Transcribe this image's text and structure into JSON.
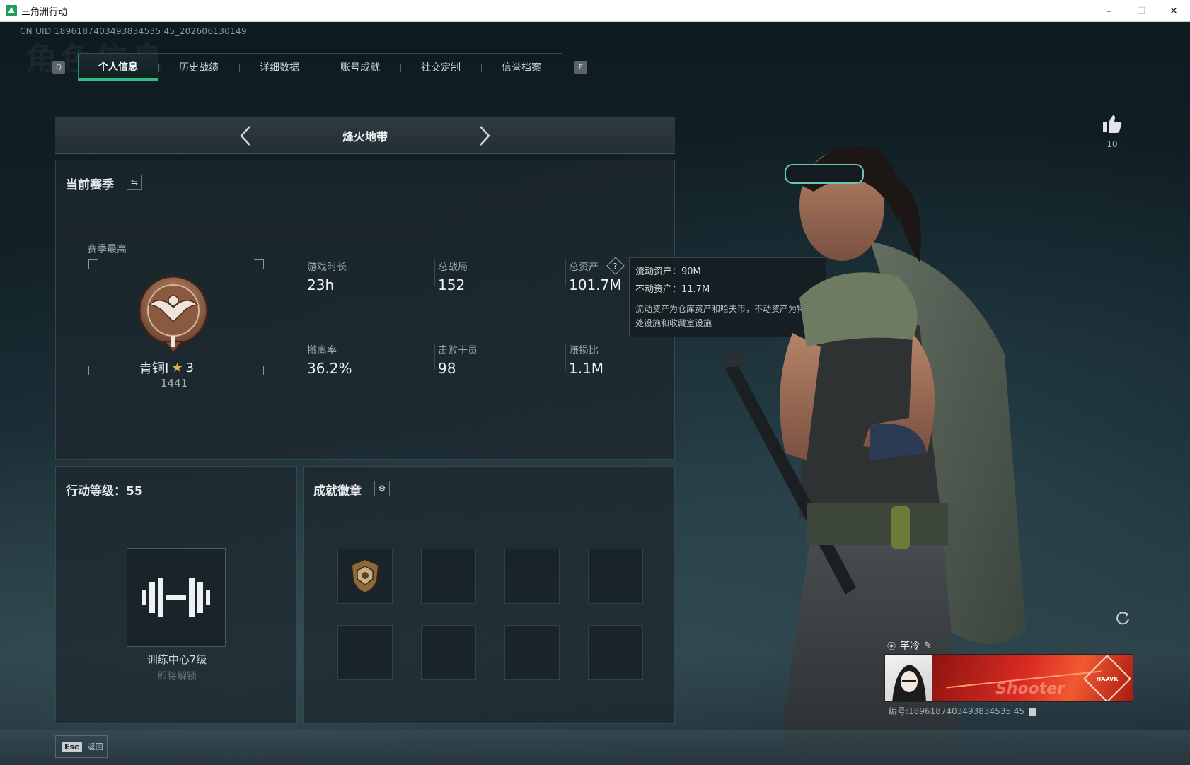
{
  "window": {
    "title": "三角洲行动",
    "controls": [
      "–",
      "☐",
      "✕"
    ]
  },
  "uid_line": "CN UID 1896187403493834535 45_202606130149",
  "watermark": "角色信息",
  "tabs": {
    "left_key": "Q",
    "right_key": "E",
    "items": [
      {
        "label": "个人信息",
        "active": true
      },
      {
        "label": "历史战绩",
        "active": false
      },
      {
        "label": "详细数据",
        "active": false
      },
      {
        "label": "账号成就",
        "active": false
      },
      {
        "label": "社交定制",
        "active": false
      },
      {
        "label": "信誉档案",
        "active": false
      }
    ]
  },
  "mode": {
    "title": "烽火地带"
  },
  "season": {
    "title": "当前赛季",
    "best_label": "赛季最高",
    "rank_name": "青铜I",
    "rank_stars": "3",
    "rank_score": "1441",
    "stats": {
      "play_time_label": "游戏时长",
      "play_time": "23h",
      "total_matches_label": "总战局",
      "total_matches": "152",
      "total_assets_label": "总资产",
      "total_assets": "101.7M",
      "extract_rate_label": "撤离率",
      "extract_rate": "36.2%",
      "kills_label": "击败干员",
      "kills": "98",
      "profit_ratio_label": "赚损比",
      "profit_ratio": "1.1M"
    }
  },
  "tooltip": {
    "liquid": "流动资产：90M",
    "fixed": "不动资产：11.7M",
    "desc": "流动资产为仓库资产和哈夫币，不动资产为特勤处设施和收藏室设施"
  },
  "level": {
    "title": "行动等级：55",
    "item_name": "训练中心7级",
    "item_status": "即将解锁"
  },
  "badges": {
    "title": "成就徽章",
    "slots": 8,
    "filled": 1
  },
  "likes": {
    "count": "10"
  },
  "player": {
    "name": "竿冷",
    "banner_brand": "HAAVK",
    "banner_text": "Shooter",
    "id_line": "编号:1896187403493834535 45"
  },
  "footer": {
    "esc_key": "Esc",
    "esc_label": "返回"
  },
  "colors": {
    "accent_green": "#2fbf85",
    "banner_red": "#d92a22",
    "rank_bronze": "#9a6a4a"
  }
}
